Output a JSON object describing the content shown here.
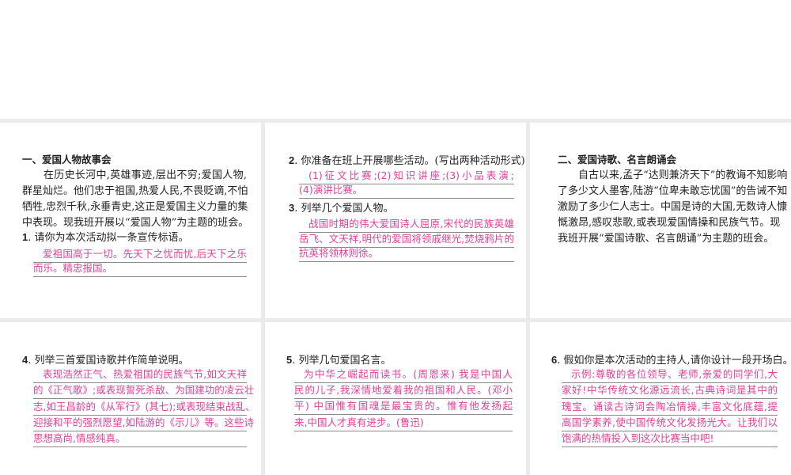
{
  "card1": {
    "heading": "一、爱国人物故事会",
    "para": [
      "在历史长河中,英雄事迹,层出不穷;爱国人物,",
      "群星灿烂。他们忠于祖国,热爱人民,不畏贬谪,不怕",
      "牺牲,忠烈千秋,永垂青史,这正是爱国主义力量的集",
      "中表现。现我班开展以“爱国人物”为主题的班会。"
    ],
    "q_num": "1",
    "question": ". 请你为本次活动拟一条宣传标语。",
    "answer": [
      "爱祖国高于一切。先天下之忧而忧,后天下之乐",
      "而乐。精忠报国。"
    ]
  },
  "card2": {
    "q2_num": "2",
    "q2": ". 你准备在班上开展哪些活动。(写出两种活动形式)",
    "a2": [
      "(1)征文比赛;(2)知识讲座;(3)小品表演;",
      "(4)演讲比赛。"
    ],
    "q3_num": "3",
    "q3": ". 列举几个爱国人物。",
    "a3": [
      "战国时期的伟大爱国诗人屈原,宋代的民族英雄",
      "岳飞、文天祥,明代的爱国将领戚继光,焚烧鸦片的",
      "抗英将领林则徐。"
    ]
  },
  "card3": {
    "heading": "二、爱国诗歌、名言朗诵会",
    "para": [
      "自古以来,孟子“达则兼济天下”的教诲不知影响",
      "了多少文人墨客,陆游“位卑未敢忘忧国”的告诫不知",
      "激励了多少仁人志士。中国是诗的大国,无数诗人慷",
      "慨激昂,感叹悲歌,或表现爱国情操和民族气节。现",
      "我班开展“爱国诗歌、名言朗诵”为主题的班会。"
    ]
  },
  "card4": {
    "q_num": "4",
    "question": ". 列举三首爱国诗歌并作简单说明。",
    "answer": [
      "表现浩然正气、热爱祖国的民族气节,如文天祥",
      "的《正气歌》;或表现誓死杀敌、为国建功的凌云壮",
      "志,如王昌龄的《从军行》(其七);或表现结束战乱、",
      "迎接和平的强烈愿望,如陆游的《示儿》等。这些诗",
      "思想高尚,情感纯真。"
    ]
  },
  "card5": {
    "q_num": "5",
    "question": ". 列举几句爱国名言。",
    "answer": [
      "为中华之崛起而读书。(周恩来)  我是中国人",
      "民的儿子,我深情地爱着我的祖国和人民。(邓小",
      "平)  中国惟有国魂是最宝贵的。惟有他发扬起",
      "来,中国人才真有进步。(鲁迅)"
    ]
  },
  "card6": {
    "q_num": "6",
    "question": ". 假如你是本次活动的主持人,请你设计一段开场白。",
    "answer": [
      "示例:尊敬的各位领导、老师,亲爱的同学们,大",
      "家好!中华传统文化源远流长,古典诗词是其中的",
      "瑰宝。诵读古诗词会陶冶情操,丰富文化底蕴,提",
      "高国学素养,使中国传统文化发扬光大。让我们以",
      "饱满的热情投入到这次比赛当中吧!"
    ]
  }
}
